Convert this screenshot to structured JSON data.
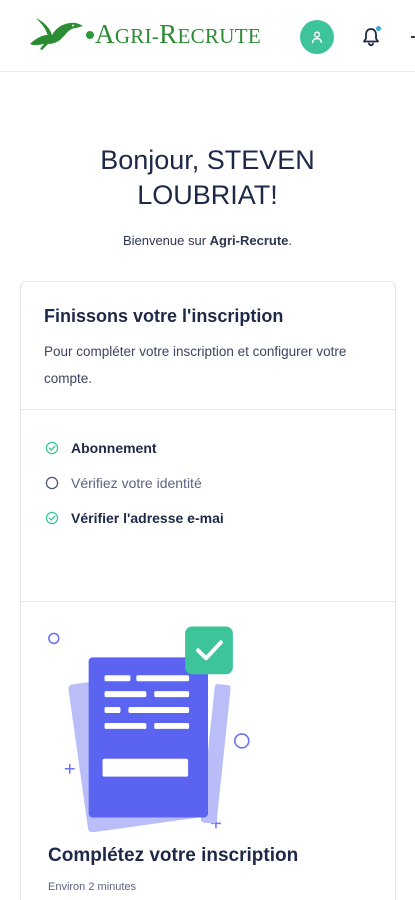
{
  "header": {
    "logo_text_first": "A",
    "logo_text_mid": "GRI-",
    "logo_text_r": "R",
    "logo_text_end": "ECRUTE",
    "avatar_icon": "user-icon",
    "bell_icon": "bell-icon",
    "colors": {
      "brand": "#2b8c33",
      "avatar": "#3ec49a",
      "notification": "#3aa6e0"
    }
  },
  "greeting": {
    "line1": "Bonjour, STEVEN",
    "line2": "LOUBRIAT!"
  },
  "welcome": {
    "prefix": "Bienvenue sur ",
    "brand": "Agri-Recrute",
    "suffix": "."
  },
  "card": {
    "title": "Finissons votre l'inscription",
    "subtitle": "Pour compléter votre inscription et configurer votre compte.",
    "steps": [
      {
        "label": "Abonnement",
        "status": "done",
        "icon": "check-circle-icon"
      },
      {
        "label": "Vérifiez votre identité",
        "status": "todo",
        "icon": "empty-circle-icon"
      },
      {
        "label": "Vérifier l'adresse e-mai",
        "status": "done",
        "icon": "check-circle-icon"
      }
    ],
    "cta_title": "Complétez votre inscription",
    "cta_sub": "Environ 2 minutes",
    "colors": {
      "accent": "#3ec49a",
      "document": "#5b64f0",
      "document_back": "#b9bdf8"
    }
  }
}
